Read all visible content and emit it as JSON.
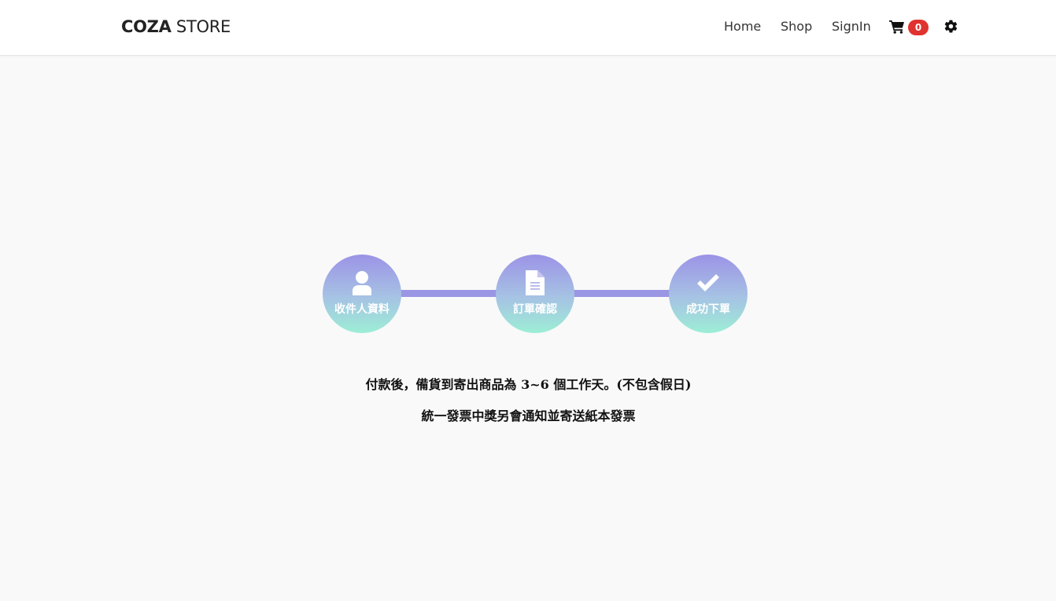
{
  "header": {
    "logo_bold": "COZA",
    "logo_light": " STORE",
    "nav": {
      "home": "Home",
      "shop": "Shop",
      "signin": "SignIn"
    },
    "cart": {
      "icon": "cart-icon",
      "count": "0"
    },
    "settings_icon": "gear-icon"
  },
  "steps": [
    {
      "label": "收件人資料",
      "icon": "user-icon"
    },
    {
      "label": "訂單確認",
      "icon": "file-icon"
    },
    {
      "label": "成功下單",
      "icon": "check-icon"
    }
  ],
  "messages": {
    "line1": "付款後，備貨到寄出商品為 3~6 個工作天。(不包含假日)",
    "line2": "統一發票中獎另會通知並寄送紙本發票"
  },
  "colors": {
    "accent": "#9b96e4",
    "gradient_top": "#9c93e6",
    "gradient_bottom": "#9ceed5",
    "badge": "#e0322f"
  }
}
